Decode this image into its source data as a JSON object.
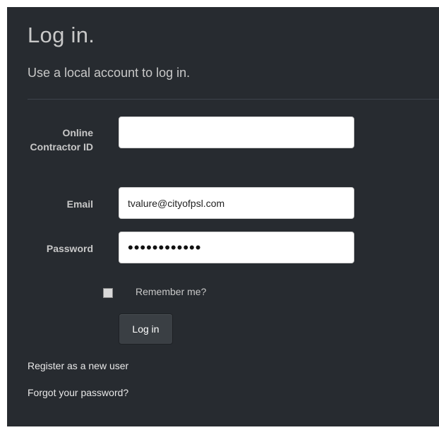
{
  "header": {
    "title": "Log in.",
    "subtitle": "Use a local account to log in."
  },
  "form": {
    "contractor_id": {
      "label": "Online Contractor ID",
      "value": ""
    },
    "email": {
      "label": "Email",
      "value": "tvalure@cityofpsl.com"
    },
    "password": {
      "label": "Password",
      "value": "passwordtext"
    },
    "remember": {
      "label": "Remember me?",
      "checked": false
    },
    "submit_label": "Log in"
  },
  "links": {
    "register": "Register as a new user",
    "forgot": "Forgot your password?"
  }
}
